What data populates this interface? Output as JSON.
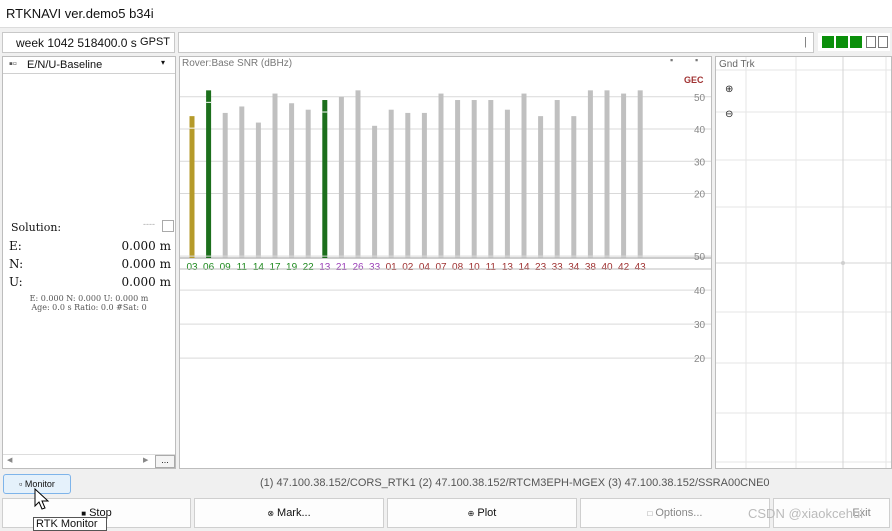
{
  "window": {
    "title": "RTKNAVI ver.demo5 b34i"
  },
  "time": {
    "week_time": "week 1042 518400.0 s",
    "system": "GPST"
  },
  "status": {
    "separator": "|"
  },
  "indicator": {
    "colors": [
      "#0a8f0a",
      "#0a8f0a",
      "#0a8f0a",
      "#ffffff",
      "#ffffff"
    ]
  },
  "solution_panel": {
    "mode_label": "E/N/U-Baseline",
    "mode_icon": "chevron-down-icon",
    "solution_label": "Solution:",
    "solution_status": "----",
    "rows": [
      {
        "key": "E:",
        "value": "0.000 m"
      },
      {
        "key": "N:",
        "value": "0.000 m"
      },
      {
        "key": "U:",
        "value": "0.000 m"
      }
    ],
    "detail_line1": "E: 0.000 N: 0.000 U: 0.000 m",
    "detail_line2": "Age: 0.0 s Ratio: 0.0 #Sat: 0",
    "more_label": "..."
  },
  "snr_panel": {
    "title": "Rover:Base  SNR (dBHz)",
    "constellation_label": "GEC"
  },
  "chart_data": {
    "type": "bar",
    "title": "Rover:Base  SNR (dBHz)",
    "ylim": [
      0,
      58
    ],
    "yticks": [
      20,
      30,
      40,
      50
    ],
    "legend": "GEC",
    "categories": [
      "03",
      "06",
      "09",
      "11",
      "14",
      "17",
      "19",
      "22",
      "13",
      "21",
      "26",
      "33",
      "01",
      "02",
      "04",
      "07",
      "08",
      "10",
      "11",
      "13",
      "14",
      "23",
      "33",
      "34",
      "38",
      "40",
      "42",
      "43"
    ],
    "category_colors": [
      "#1f8a1f",
      "#1f8a1f",
      "#1f8a1f",
      "#1f8a1f",
      "#1f8a1f",
      "#1f8a1f",
      "#1f8a1f",
      "#1f8a1f",
      "#9b3fb8",
      "#9b3fb8",
      "#9b3fb8",
      "#9b3fb8",
      "#a03232",
      "#a03232",
      "#a03232",
      "#a03232",
      "#a03232",
      "#a03232",
      "#a03232",
      "#a03232",
      "#a03232",
      "#a03232",
      "#a03232",
      "#a03232",
      "#a03232",
      "#a03232",
      "#a03232",
      "#a03232"
    ],
    "rover_values": [
      44,
      52,
      45,
      47,
      42,
      51,
      48,
      46,
      49,
      50,
      52,
      41,
      46,
      45,
      45,
      51,
      49,
      49,
      49,
      46,
      51,
      44,
      49,
      44,
      52,
      52,
      51,
      52
    ],
    "bar_colors": [
      "#b59a2a",
      "#1c6f1c",
      "#c0c0c0",
      "#c0c0c0",
      "#c0c0c0",
      "#c0c0c0",
      "#c0c0c0",
      "#c0c0c0",
      "#1c6f1c",
      "#c0c0c0",
      "#c0c0c0",
      "#c0c0c0",
      "#c0c0c0",
      "#c0c0c0",
      "#c0c0c0",
      "#c0c0c0",
      "#c0c0c0",
      "#c0c0c0",
      "#c0c0c0",
      "#c0c0c0",
      "#c0c0c0",
      "#c0c0c0",
      "#c0c0c0",
      "#c0c0c0",
      "#c0c0c0",
      "#c0c0c0",
      "#c0c0c0",
      "#c0c0c0"
    ],
    "base_values": [],
    "grid": true
  },
  "track_panel": {
    "title": "Gnd Trk",
    "zoom_in_icon": "zoom-in-icon",
    "zoom_out_icon": "zoom-out-icon",
    "zoom_in_glyph": "⊕",
    "zoom_out_glyph": "⊖"
  },
  "footer": {
    "monitor_label": "Monitor",
    "streams": "(1) 47.100.38.152/CORS_RTK1 (2) 47.100.38.152/RTCM3EPH-MGEX (3) 47.100.38.152/SSRA00CNE0",
    "buttons": [
      {
        "label": "Stop",
        "icon": "■"
      },
      {
        "label": "Mark...",
        "icon": "⊗"
      },
      {
        "label": "Plot",
        "icon": "⊕"
      },
      {
        "label": "Options...",
        "icon": "□"
      },
      {
        "label": "Exit",
        "icon": ""
      }
    ],
    "tooltip": "RTK Monitor"
  },
  "watermark": "CSDN @xiaokcehui"
}
